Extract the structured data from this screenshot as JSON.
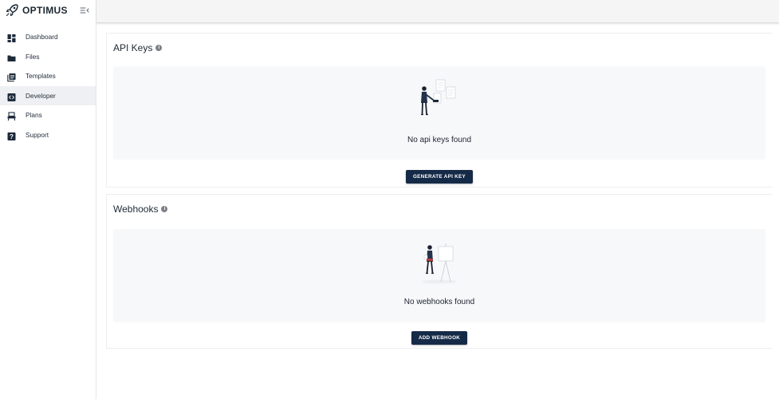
{
  "brand": {
    "name": "OPTIMUS",
    "logo_icon": "rocket-icon",
    "collapse_icon": "menu-collapse-icon"
  },
  "sidebar": {
    "active_item": "Developer",
    "items": [
      {
        "label": "Dashboard",
        "icon": "dashboard-icon"
      },
      {
        "label": "Files",
        "icon": "folder-icon"
      },
      {
        "label": "Templates",
        "icon": "templates-icon"
      },
      {
        "label": "Developer",
        "icon": "code-icon"
      },
      {
        "label": "Plans",
        "icon": "plans-icon"
      },
      {
        "label": "Support",
        "icon": "help-icon"
      }
    ]
  },
  "api_keys": {
    "title": "API Keys",
    "info_icon": "info-icon",
    "empty_text": "No api keys found",
    "button_label": "GENERATE API KEY"
  },
  "webhooks": {
    "title": "Webhooks",
    "info_icon": "info-icon",
    "empty_text": "No webhooks found",
    "button_label": "ADD WEBHOOK"
  },
  "colors": {
    "primary_button": "#152a47",
    "sidebar_active": "#eef0f3",
    "topbar": "#f5f5f6",
    "empty_state_bg": "#f7f8fa"
  }
}
